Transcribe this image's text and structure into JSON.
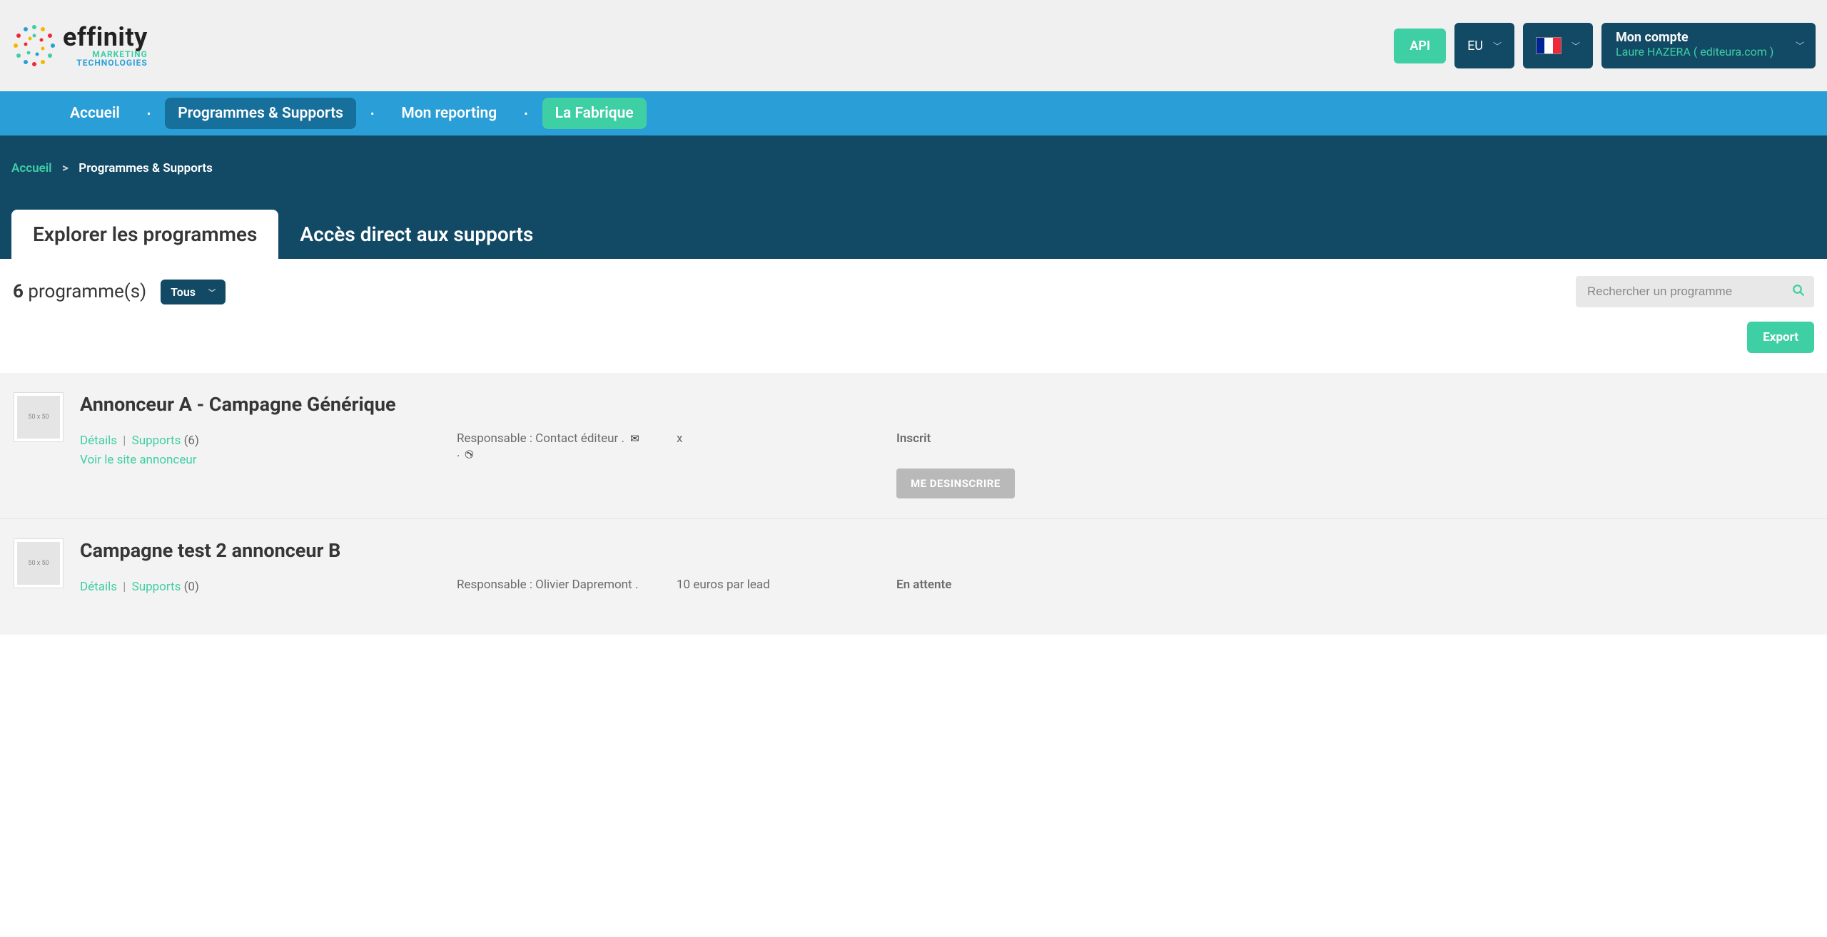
{
  "header": {
    "logo_word": "effinity",
    "logo_sub1": "MARKETING",
    "logo_sub2": "TECHNOLOGIES",
    "api_label": "API",
    "region_label": "EU",
    "account_title": "Mon compte",
    "account_user": "Laure HAZERA",
    "account_site": "editeura.com"
  },
  "nav": {
    "items": [
      "Accueil",
      "Programmes & Supports",
      "Mon reporting",
      "La Fabrique"
    ],
    "active_index": 1
  },
  "breadcrumb": {
    "root": "Accueil",
    "current": "Programmes & Supports"
  },
  "tabs": {
    "items": [
      "Explorer les programmes",
      "Accès direct aux supports"
    ],
    "active_index": 0
  },
  "panel": {
    "count_number": "6",
    "count_label": "programme(s)",
    "filter_label": "Tous",
    "search_placeholder": "Rechercher un programme",
    "export_label": "Export"
  },
  "programs": [
    {
      "title": "Annonceur A - Campagne Générique",
      "details_label": "Détails",
      "supports_label": "Supports",
      "supports_count": "(6)",
      "site_label": "Voir le site annonceur",
      "resp_prefix": "Responsable :",
      "resp_name": "Contact éditeur",
      "extra": "x",
      "status": "Inscrit",
      "action_label": "ME DESINSCRIRE",
      "thumb_text": "50 x 50"
    },
    {
      "title": "Campagne test 2 annonceur B",
      "details_label": "Détails",
      "supports_label": "Supports",
      "supports_count": "(0)",
      "site_label": "",
      "resp_prefix": "Responsable :",
      "resp_name": "Olivier Dapremont",
      "extra": "10 euros par lead",
      "status": "En attente",
      "action_label": "",
      "thumb_text": "50 x 50"
    }
  ]
}
